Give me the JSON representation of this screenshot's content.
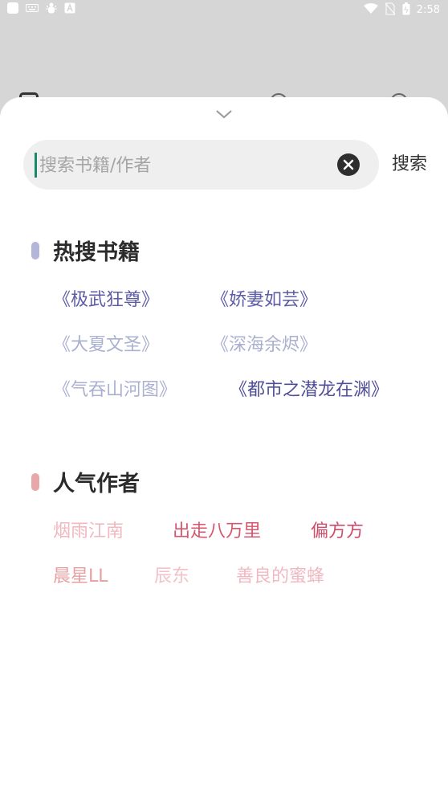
{
  "status_bar": {
    "time": "2:58",
    "left_icons": [
      "app-square-icon",
      "keyboard-icon",
      "bug-icon",
      "a-box-icon"
    ],
    "right_icons": [
      "wifi-icon",
      "no-sim-icon",
      "battery-icon"
    ]
  },
  "behind": {
    "visible": "partial row hidden behind sheet"
  },
  "search": {
    "placeholder": "搜索书籍/作者",
    "value": "",
    "button_label": "搜索"
  },
  "hot_books": {
    "title": "热搜书籍",
    "accent": "#b3b6d8",
    "items": [
      {
        "label": "《极武狂尊》",
        "color": "#5c5ca7"
      },
      {
        "label": "《娇妻如芸》",
        "color": "#5c5ca7"
      },
      {
        "label": "《大夏文圣》",
        "color": "#aab0cf"
      },
      {
        "label": "《深海余烬》",
        "color": "#aab0cf"
      },
      {
        "label": "《气吞山河图》",
        "color": "#aab0cf"
      },
      {
        "label": "《都市之潜龙在渊》",
        "color": "#4f4f98"
      }
    ]
  },
  "popular_authors": {
    "title": "人气作者",
    "accent": "#e8a7a9",
    "items": [
      {
        "label": "烟雨江南",
        "color": "#f1b8be"
      },
      {
        "label": "出走八万里",
        "color": "#d9556e"
      },
      {
        "label": "偏方方",
        "color": "#d04c6a"
      },
      {
        "label": "晨星LL",
        "color": "#e7a0a2"
      },
      {
        "label": "辰东",
        "color": "#f2c2c8"
      },
      {
        "label": "善良的蜜蜂",
        "color": "#f0b8c0"
      }
    ]
  }
}
